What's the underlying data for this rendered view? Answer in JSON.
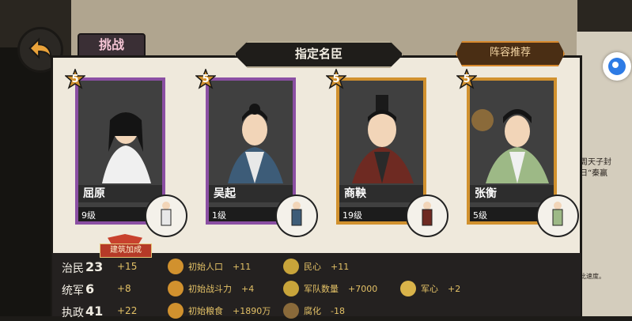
{
  "header": {
    "challenge_label": "挑战",
    "title": "指定名臣",
    "lineup_button": "阵容推荐"
  },
  "cards": [
    {
      "name": "屈原",
      "level": "9级",
      "stars": "5",
      "frame": "purple"
    },
    {
      "name": "吴起",
      "level": "1级",
      "stars": "5",
      "frame": "purple"
    },
    {
      "name": "商鞅",
      "level": "19级",
      "stars": "5",
      "frame": "gold"
    },
    {
      "name": "张衡",
      "level": "5级",
      "stars": "5",
      "frame": "gold"
    }
  ],
  "build_bonus_label": "建筑加成",
  "stats": [
    {
      "label": "治民",
      "value": "23",
      "bonus": "+15",
      "effects": [
        {
          "icon": "population-icon",
          "text": "初始人口",
          "value": "+11"
        },
        {
          "icon": "people-heart-icon",
          "text": "民心",
          "value": "+11"
        }
      ]
    },
    {
      "label": "统军",
      "value": "6",
      "bonus": "+8",
      "effects": [
        {
          "icon": "combat-power-icon",
          "text": "初始战斗力",
          "value": "+4"
        },
        {
          "icon": "troops-icon",
          "text": "军队数量",
          "value": "+7000"
        },
        {
          "icon": "military-morale-icon",
          "text": "军心",
          "value": "+2"
        }
      ]
    },
    {
      "label": "执政",
      "value": "41",
      "bonus": "+22",
      "effects": [
        {
          "icon": "food-icon",
          "text": "初始粮食",
          "value": "+1890万"
        },
        {
          "icon": "corruption-icon",
          "text": "腐化",
          "value": "-18"
        }
      ]
    }
  ],
  "side_text": {
    "line1": "周天子封",
    "line2": "日“秦赢",
    "line3": "此速度。"
  },
  "colors": {
    "purple_frame": "#8b4fa3",
    "gold_frame": "#d1912e",
    "bonus_yellow": "#e3c166"
  }
}
